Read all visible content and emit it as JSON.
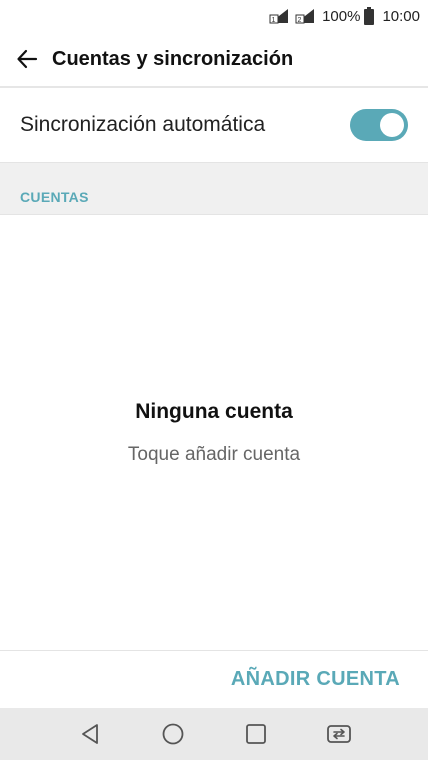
{
  "status_bar": {
    "battery_percent": "100%",
    "time": "10:00",
    "icons": [
      "sim1-signal-icon",
      "sim2-signal-icon",
      "battery-icon"
    ]
  },
  "header": {
    "back_icon": "arrow-left-icon",
    "title": "Cuentas y sincronización"
  },
  "auto_sync": {
    "label": "Sincronización automática",
    "enabled": true
  },
  "accounts_section": {
    "title": "CUENTAS"
  },
  "empty_state": {
    "title": "Ninguna cuenta",
    "subtitle": "Toque añadir cuenta"
  },
  "footer": {
    "add_account_label": "AÑADIR CUENTA"
  },
  "nav_bar": {
    "icons": [
      "back-triangle-icon",
      "home-circle-icon",
      "recents-square-icon",
      "dual-window-icon"
    ]
  },
  "colors": {
    "accent": "#5aa9b7",
    "toggle_on": "#5aa9b7",
    "section_bg": "#f0f0f0",
    "nav_bg": "#e9e9e9",
    "subtitle": "#666666"
  }
}
